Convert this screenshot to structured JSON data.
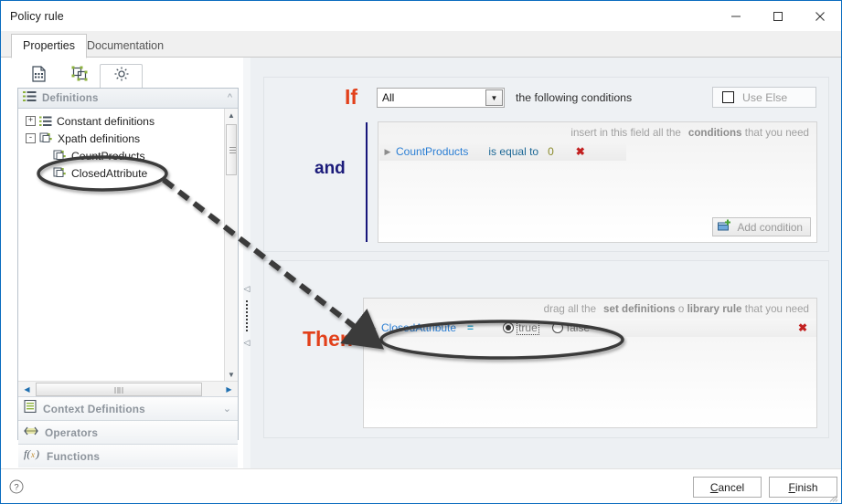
{
  "window": {
    "title": "Policy rule",
    "minimize_icon": "minimize-icon",
    "maximize_icon": "maximize-icon",
    "close_icon": "close-icon"
  },
  "tabs": [
    {
      "label": "Properties",
      "active": true
    },
    {
      "label": "Documentation",
      "active": false
    }
  ],
  "left_pane": {
    "icon_tabs": [
      {
        "name": "document-icon",
        "active": false
      },
      {
        "name": "shapes-icon",
        "active": false
      },
      {
        "name": "gear-icon",
        "active": true
      }
    ],
    "panel": {
      "title": "Definitions",
      "icon": "list-icon",
      "collapse_icon": "chevron-up-icon"
    },
    "tree": [
      {
        "label": "Constant definitions",
        "level": 1,
        "toggle": "+",
        "icon": "list-icon"
      },
      {
        "label": "Xpath definitions",
        "level": 1,
        "toggle": "-",
        "icon": "xpath-icon"
      },
      {
        "label": "CountProducts",
        "level": 2,
        "icon": "xpath-icon"
      },
      {
        "label": "ClosedAttribute",
        "level": 2,
        "icon": "xpath-icon",
        "highlighted": true
      }
    ],
    "accordion": [
      {
        "label": "Context Definitions",
        "icon": "context-icon",
        "chevron": "chevron-down-icon"
      },
      {
        "label": "Operators",
        "icon": "operators-icon"
      },
      {
        "label": "Functions",
        "icon": "functions-icon"
      }
    ],
    "scrollbars": {
      "v_up": "scroll-up-arrow",
      "v_down": "scroll-down-arrow",
      "h_left": "scroll-left-arrow",
      "h_right": "scroll-right-arrow"
    }
  },
  "splitter": {
    "collapse_arrow_top": "collapse-left-arrow",
    "collapse_arrow_bottom": "collapse-left-arrow"
  },
  "rule": {
    "if": {
      "keyword": "If",
      "match_mode": "All",
      "match_mode_options": [
        "All"
      ],
      "following_text": "the following conditions",
      "use_else_label": "Use Else",
      "use_else_checked": false,
      "and_keyword": "and",
      "hint": {
        "part1": "insert in this field all the",
        "part2": "conditions",
        "part3": "that you need"
      },
      "conditions": [
        {
          "field": "CountProducts",
          "operator": "is equal to",
          "value": "0",
          "delete_icon": "delete-x-icon"
        }
      ],
      "add_condition_label": "Add condition"
    },
    "then": {
      "keyword": "Then",
      "hint": {
        "part1": "drag all the",
        "part2": "set definitions",
        "part3": "o",
        "part4": "library rule",
        "part5": "that you need"
      },
      "actions": [
        {
          "field": "ClosedAttribute",
          "operator": "=",
          "radio_true_label": "true",
          "radio_false_label": "false",
          "selected": "true",
          "delete_icon": "delete-x-icon"
        }
      ]
    }
  },
  "footer": {
    "help_icon": "help-icon",
    "cancel_label": "Cancel",
    "cancel_mnemonic": "C",
    "finish_label": "Finish",
    "finish_mnemonic": "F"
  },
  "colors": {
    "keyword_red": "#e2401a",
    "and_blue": "#1b1b7a",
    "field_blue": "#2c7fd4",
    "operator_blue": "#1d6896",
    "value_olive": "#8a8a2a",
    "delete_red": "#c22020",
    "window_border": "#0a6cbf"
  }
}
